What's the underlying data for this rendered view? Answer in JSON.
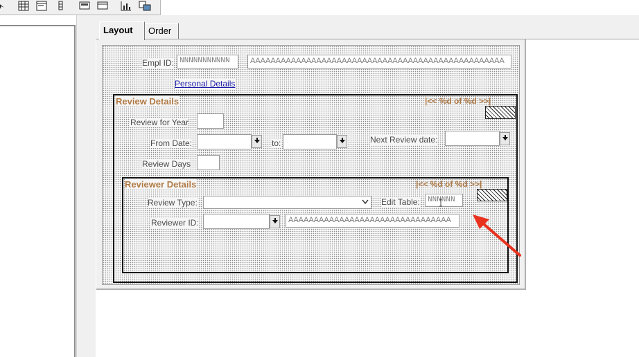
{
  "toolbar": {
    "icons": [
      "grid-icon",
      "form-icon",
      "pin-icon",
      "page-layout-icon",
      "window-icon",
      "chart-icon",
      "database-icon"
    ]
  },
  "tabs": [
    {
      "label": "Layout",
      "active": true
    },
    {
      "label": "Order",
      "active": false
    }
  ],
  "header": {
    "empl_id_label": "Empl ID:",
    "empl_id_value": "NNNNNNNNNNN",
    "empl_name_value": "AAAAAAAAAAAAAAAAAAAAAAAAAAAAAAAAAAAAAAAAAAAAAAAAAA",
    "personal_details_link": "Personal Details"
  },
  "review_details": {
    "title": "Review Details",
    "nav": "|<< %d of %d >>|",
    "review_for_year_label": "Review for Year",
    "from_date_label": "From Date:",
    "to_label": "to:",
    "next_review_date_label": "Next Review date:",
    "review_days_label": "Review Days"
  },
  "reviewer_details": {
    "title": "Reviewer Details",
    "nav": "|<< %d of %d >>|",
    "review_type_label": "Review Type:",
    "edit_table_label": "Edit Table:",
    "edit_table_value": "NNNNNN",
    "reviewer_id_label": "Reviewer ID:",
    "reviewer_name_value": "AAAAAAAAAAAAAAAAAAAAAAAAAAAAAAAA"
  },
  "colors": {
    "group_title": "#b07a45",
    "link": "#1a1aa6",
    "arrow": "#e8321e"
  }
}
